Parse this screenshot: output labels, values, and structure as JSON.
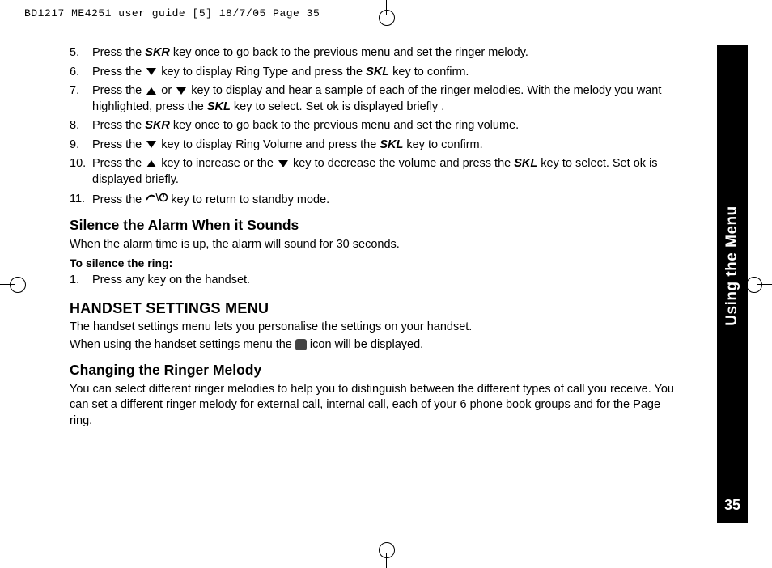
{
  "slug": "BD1217 ME4251 user guide [5]  18/7/05   Page 35",
  "sidebar": {
    "section": "Using the Menu",
    "page": "35"
  },
  "steps_a": [
    {
      "n": "5.",
      "pre": "Press the ",
      "key": "SKR",
      "post": " key once to go back to the previous menu and set the ringer melody."
    },
    {
      "n": "6.",
      "pre": "Press the ",
      "tri": "down",
      "mid": " key to display Ring Type and press the ",
      "key": "SKL",
      "post": " key to confirm."
    },
    {
      "n": "7.",
      "pre": "Press the ",
      "tri": "up",
      "or": " or ",
      "tri2": "down",
      "mid": "  key to display and hear a sample of each of the ringer melodies. With the melody you want highlighted, press the ",
      "key": "SKL",
      "post": " key to select. Set ok  is displayed briefly ."
    },
    {
      "n": "8.",
      "pre": "Press the ",
      "key": "SKR",
      "post": " key once to go back to the previous menu and set the ring volume."
    },
    {
      "n": "9.",
      "pre": "Press the ",
      "tri": "down",
      "mid": " key to display Ring Volume and press the ",
      "key": "SKL",
      "post": " key to confirm."
    },
    {
      "n": "10.",
      "pre": "Press the ",
      "tri": "up",
      "mid": " key to increase or the ",
      "tri2": "down",
      "mid2": " key to decrease the volume and press the ",
      "key": "SKL",
      "post": " key to select. Set ok is displayed briefly."
    },
    {
      "n": "11.",
      "pre": "Press the  ",
      "icon": "standby",
      "post": " key to return to standby mode."
    }
  ],
  "silence": {
    "heading": "Silence the Alarm When it Sounds",
    "intro": "When the alarm time is up, the alarm will sound for 30 seconds.",
    "sub": "To silence the ring:",
    "step1_n": "1.",
    "step1": "Press any key on the handset."
  },
  "settings": {
    "heading": "HANDSET SETTINGS MENU",
    "line1": "The handset settings menu lets you personalise the settings on your handset.",
    "line2_pre": "When using the handset settings menu the ",
    "line2_post": " icon will be displayed."
  },
  "ringer": {
    "heading": "Changing the Ringer Melody",
    "body": "You can select different ringer melodies to help you to distinguish between the different types of call you receive. You can set a different ringer melody for external call, internal call, each of your 6 phone book groups and for the Page ring."
  }
}
